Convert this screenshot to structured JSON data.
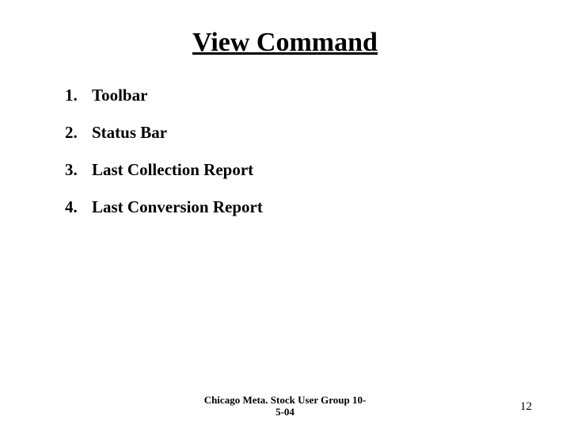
{
  "title": "View Command",
  "items": [
    {
      "number": "1.",
      "label": "Toolbar"
    },
    {
      "number": "2.",
      "label": "Status Bar"
    },
    {
      "number": "3.",
      "label": "Last Collection Report"
    },
    {
      "number": "4.",
      "label": "Last Conversion Report"
    }
  ],
  "footer": {
    "line1": "Chicago Meta. Stock User Group 10-",
    "line2": "5-04"
  },
  "page_number": "12"
}
